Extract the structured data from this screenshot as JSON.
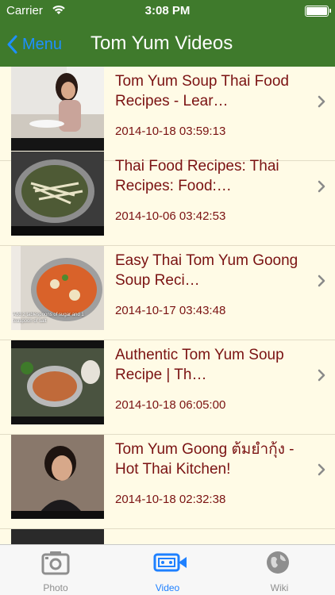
{
  "status": {
    "carrier": "Carrier",
    "time": "3:08 PM"
  },
  "nav": {
    "back_label": "Menu",
    "title": "Tom Yum Videos"
  },
  "videos": [
    {
      "title": "Tom Yum Soup Thai Food Recipes - Lear…",
      "date": "2014-10-18 03:59:13",
      "thumb_caption": ""
    },
    {
      "title": "Thai Food Recipes: Thai Recipes: Food:…",
      "date": "2014-10-06 03:42:53",
      "thumb_caption": ""
    },
    {
      "title": "Easy Thai Tom Yum Goong Soup Reci…",
      "date": "2014-10-17 03:43:48",
      "thumb_caption": "Add 2 tablespoons of sugar and 1 teaspoon of salt"
    },
    {
      "title": "Authentic Tom Yum Soup Recipe | Th…",
      "date": "2014-10-18 06:05:00",
      "thumb_caption": ""
    },
    {
      "title": "Tom Yum Goong ต้มยำกุ้ง - Hot Thai Kitchen!",
      "date": "2014-10-18 02:32:38",
      "thumb_caption": ""
    }
  ],
  "tabs": [
    {
      "label": "Photo",
      "icon": "camera-icon"
    },
    {
      "label": "Video",
      "icon": "video-camera-icon",
      "active": true
    },
    {
      "label": "Wiki",
      "icon": "globe-icon"
    }
  ],
  "colors": {
    "nav": "#3f7a2c",
    "accent": "#1e80ff",
    "title_text": "#7a1212",
    "list_bg": "#fffbe6"
  }
}
